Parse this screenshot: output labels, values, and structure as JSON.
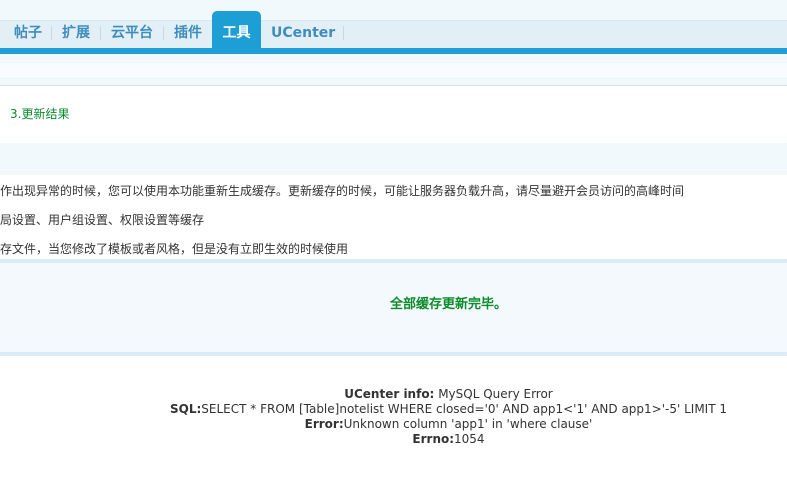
{
  "nav": {
    "items": [
      {
        "label": "帖子"
      },
      {
        "label": "扩展"
      },
      {
        "label": "云平台"
      },
      {
        "label": "插件"
      },
      {
        "label": "工具"
      },
      {
        "label": "UCenter"
      }
    ],
    "active_index": 4
  },
  "step": {
    "label": "3.更新结果"
  },
  "tips": [
    "作出现异常的时候，您可以使用本功能重新生成缓存。更新缓存的时候，可能让服务器负载升高，请尽量避开会员访问的高峰时间",
    "局设置、用户组设置、权限设置等缓存",
    "存文件，当您修改了模板或者风格，但是没有立即生效的时候使用"
  ],
  "message": {
    "text": "全部缓存更新完毕。"
  },
  "error": {
    "info_label": "UCenter info:",
    "info_value": "MySQL Query Error",
    "sql_label": "SQL:",
    "sql_value": "SELECT * FROM [Table]notelist WHERE closed='0' AND app1<'1' AND app1>'-5' LIMIT 1",
    "error_label": "Error:",
    "error_value": "Unknown column 'app1' in 'where clause'",
    "errno_label": "Errno:",
    "errno_value": "1054"
  },
  "colors": {
    "accent": "#1d9fd6",
    "success": "#0d8b2b",
    "nav_text": "#3f8dbd"
  }
}
